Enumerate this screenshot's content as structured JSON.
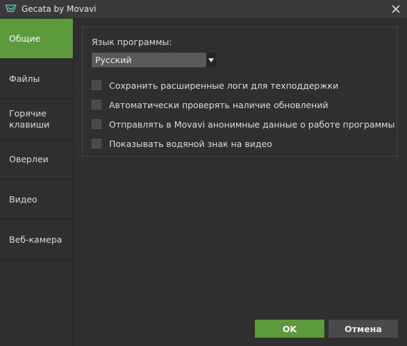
{
  "window": {
    "title": "Gecata by Movavi",
    "app_icon": "gecata-logo-icon",
    "close_icon": "close-icon"
  },
  "sidebar": {
    "items": [
      {
        "label": "Общие",
        "active": true
      },
      {
        "label": "Файлы",
        "active": false
      },
      {
        "label": "Горячие\nклавиши",
        "active": false
      },
      {
        "label": "Оверлеи",
        "active": false
      },
      {
        "label": "Видео",
        "active": false
      },
      {
        "label": "Веб-камера",
        "active": false
      }
    ]
  },
  "general": {
    "language_label": "Язык программы:",
    "language_value": "Русский",
    "options": [
      {
        "label": "Сохранить расширенные логи для техподдержки",
        "checked": false
      },
      {
        "label": "Автоматически проверять наличие обновлений",
        "checked": false
      },
      {
        "label": "Отправлять в Movavi анонимные данные о работе программы",
        "checked": false
      },
      {
        "label": "Показывать водяной знак на видео",
        "checked": false
      }
    ]
  },
  "buttons": {
    "ok": "OK",
    "cancel": "Отмена"
  },
  "colors": {
    "accent": "#5c9a3c",
    "background": "#2f2f30",
    "titlebar": "#3a3a3b",
    "logo": "#58c3b5"
  }
}
